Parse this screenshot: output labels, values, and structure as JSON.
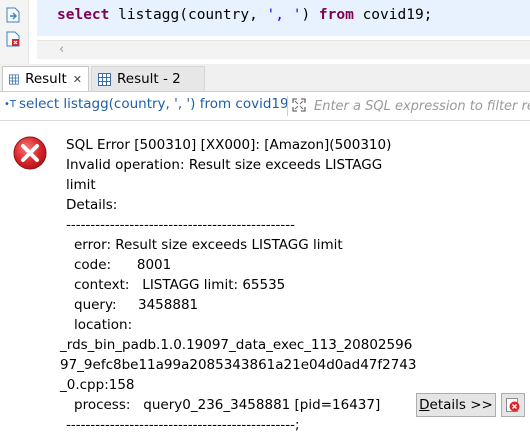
{
  "editor": {
    "code_keyword_select": "select",
    "code_mid": " listagg(country, ",
    "code_string": "', '",
    "code_close": ") ",
    "code_keyword_from": "from",
    "code_tail": " covid19;",
    "scroll_arrow": "‹"
  },
  "tabs": [
    {
      "label": "Result",
      "close": "✕",
      "active": true
    },
    {
      "label": "Result - 2",
      "active": false
    }
  ],
  "filter": {
    "query_text": "select listagg(country, ', ') from covid19",
    "placeholder": "Enter a SQL expression to filter results"
  },
  "error": {
    "lines": [
      "SQL Error [500310] [XX000]: [Amazon](500310)",
      "Invalid operation: Result size exceeds LISTAGG",
      "limit",
      "Details:",
      "-----------------------------------------------",
      "error:  Result size exceeds LISTAGG limit",
      "code:      8001",
      "context:   LISTAGG limit: 65535",
      "query:     3458881",
      "location:",
      "_rds_bin_padb.1.0.19097_data_exec_113_20802596",
      "97_9efc8be11a99a2085343861a21e04d0ad47f2743",
      "_0.cpp:158",
      "process:   query0_236_3458881 [pid=16437]",
      "-----------------------------------------------;"
    ],
    "details_button_label": "etails >>",
    "details_button_mnemonic": "D"
  },
  "colors": {
    "keyword": "#7f0055",
    "string": "#2a00ff",
    "query_chip": "#1d5fa7",
    "error_red": "#d9262a"
  },
  "icons": {
    "gutter_1": "script-execute-icon",
    "gutter_2": "script-file-icon",
    "tab_result": "grid-icon",
    "filter": "expand-filter-icon",
    "error": "error-circle-x-icon",
    "report": "error-report-icon"
  }
}
